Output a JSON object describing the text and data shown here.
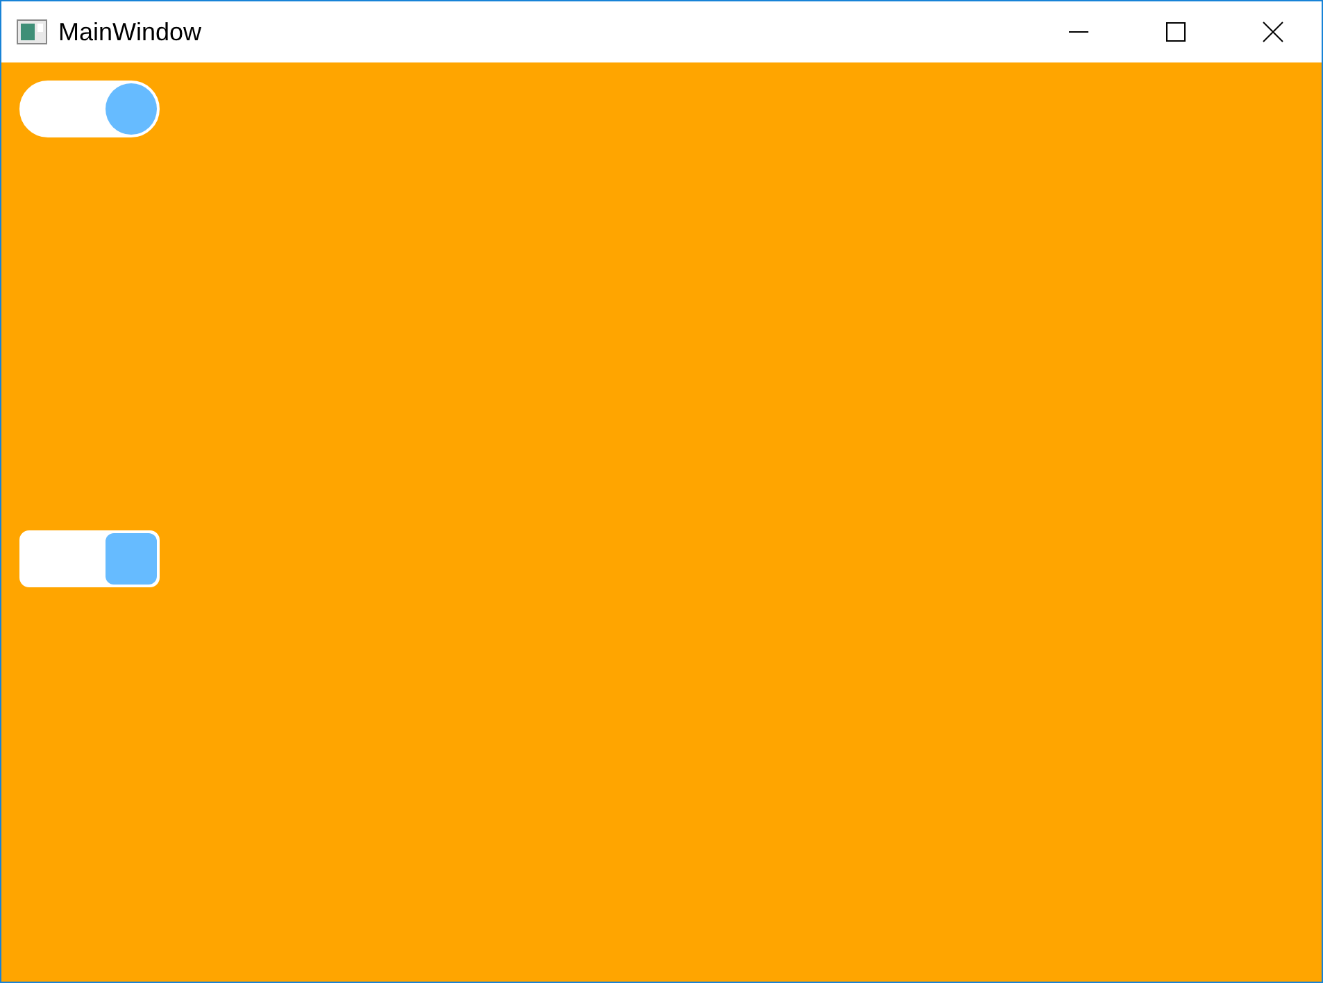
{
  "window": {
    "title": "MainWindow"
  },
  "toggles": [
    {
      "kind": "round",
      "on": true
    },
    {
      "kind": "square",
      "on": true
    }
  ]
}
